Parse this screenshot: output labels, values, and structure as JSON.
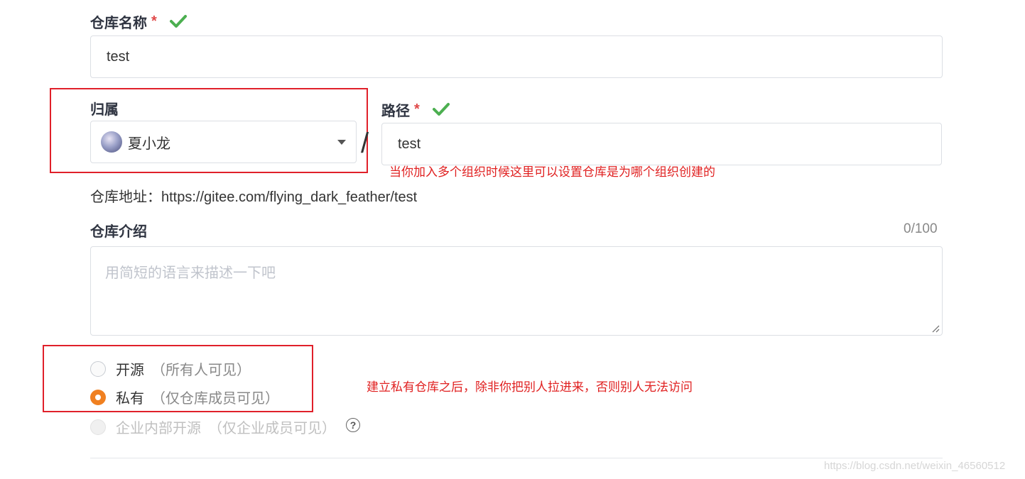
{
  "repo_name": {
    "label": "仓库名称",
    "required_mark": "*",
    "value": "test"
  },
  "owner": {
    "label": "归属",
    "selected": "夏小龙",
    "separator": "/"
  },
  "path": {
    "label": "路径",
    "required_mark": "*",
    "value": "test"
  },
  "annotation_owner": "当你加入多个组织时候这里可以设置仓库是为哪个组织创建的",
  "repo_url": "仓库地址：https://gitee.com/flying_dark_feather/test",
  "description": {
    "label": "仓库介绍",
    "counter": "0/100",
    "placeholder": "用简短的语言来描述一下吧"
  },
  "visibility": {
    "open_label": "开源",
    "open_hint": "（所有人可见）",
    "private_label": "私有",
    "private_hint": "（仅仓库成员可见）",
    "enterprise_label": "企业内部开源",
    "enterprise_hint": "（仅企业成员可见）",
    "help_icon": "?",
    "selected": "private"
  },
  "annotation_private": "建立私有仓库之后，除非你把别人拉进来，否则别人无法访问",
  "watermark": "https://blog.csdn.net/weixin_46560512",
  "colors": {
    "accent": "#f08020",
    "check_green": "#4caf50",
    "annotation_red": "#e02020"
  }
}
